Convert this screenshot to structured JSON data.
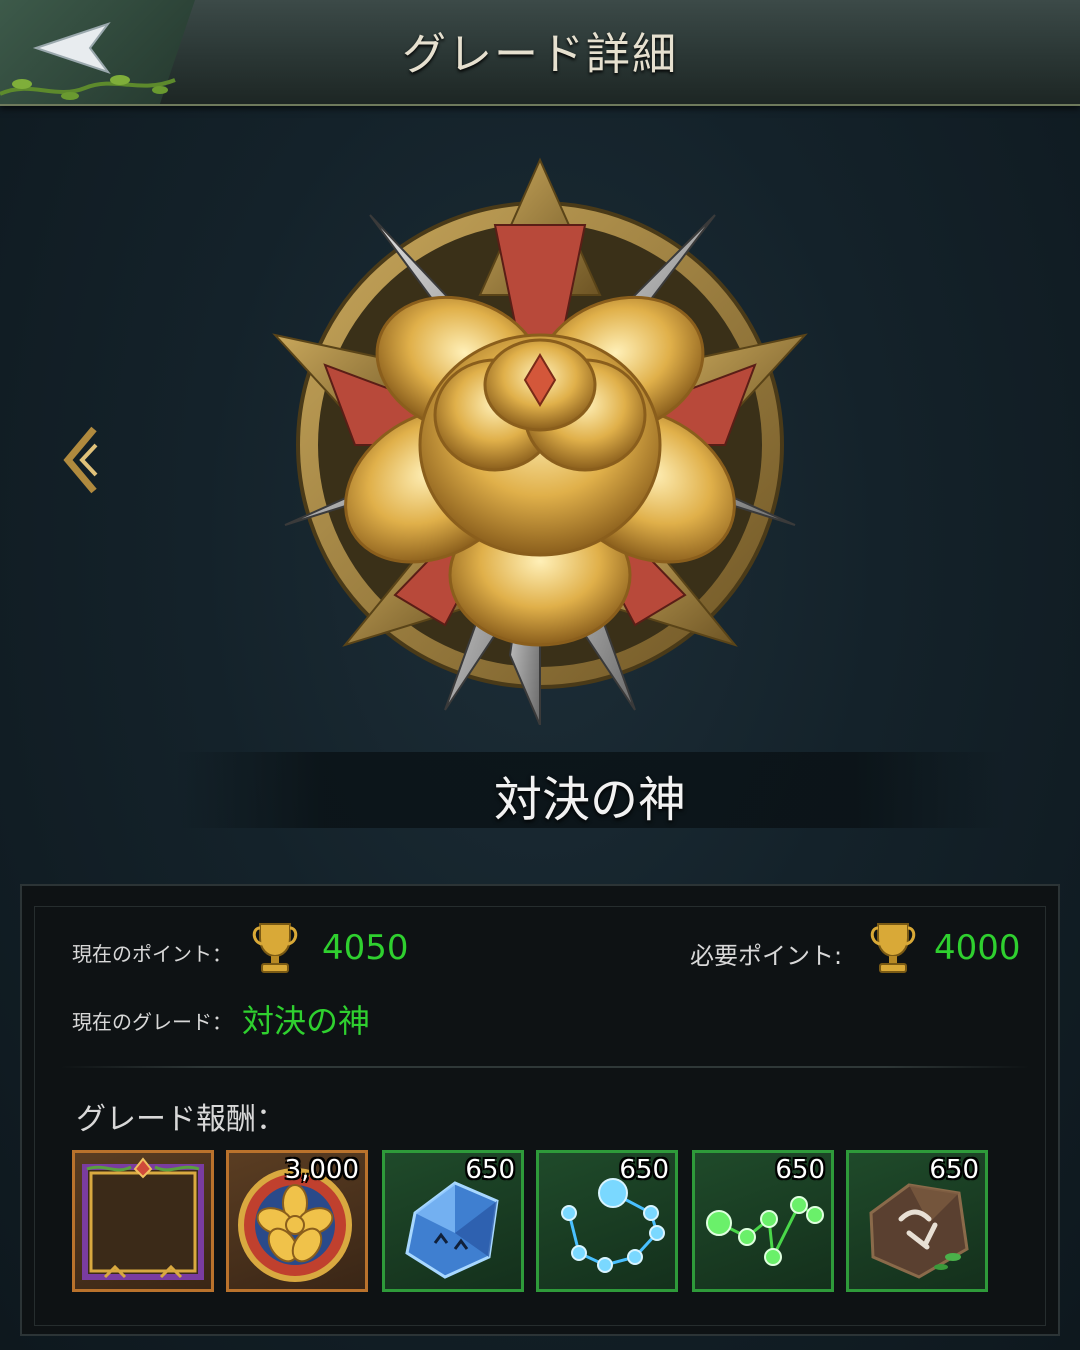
{
  "header": {
    "title": "グレード詳細"
  },
  "grade": {
    "name": "対決の神"
  },
  "stats": {
    "current_points_label": "現在のポイント：",
    "current_points_value": "4050",
    "required_points_label": "必要ポイント:",
    "required_points_value": "4000",
    "current_grade_label": "現在のグレード：",
    "current_grade_value": "対決の神"
  },
  "rewards": {
    "title": "グレード報酬：",
    "items": [
      {
        "icon": "avatar-frame-icon",
        "count": ""
      },
      {
        "icon": "grade-coin-icon",
        "count": "3,000"
      },
      {
        "icon": "blue-crystal-icon",
        "count": "650"
      },
      {
        "icon": "blue-constellation-icon",
        "count": "650"
      },
      {
        "icon": "green-constellation-icon",
        "count": "650"
      },
      {
        "icon": "rune-stone-icon",
        "count": "650"
      }
    ]
  },
  "colors": {
    "accent_green": "#2fd02f",
    "gold_border": "#b9722c",
    "green_border": "#2e9a3a"
  }
}
